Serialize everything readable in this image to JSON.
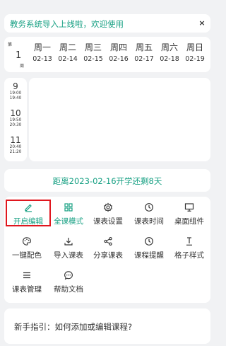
{
  "notice": {
    "text": "教务系统导入上线啦，欢迎使用",
    "close_glyph": "×"
  },
  "week": {
    "prefix": "第",
    "number": "1",
    "suffix": "周",
    "days": [
      {
        "name": "周一",
        "date": "02-13"
      },
      {
        "name": "周二",
        "date": "02-14"
      },
      {
        "name": "周三",
        "date": "02-15"
      },
      {
        "name": "周四",
        "date": "02-16"
      },
      {
        "name": "周五",
        "date": "02-17"
      },
      {
        "name": "周六",
        "date": "02-18"
      },
      {
        "name": "周日",
        "date": "02-19"
      }
    ]
  },
  "periods": [
    {
      "num": "9",
      "start": "19:00",
      "end": "19:40"
    },
    {
      "num": "10",
      "start": "19:50",
      "end": "20:30"
    },
    {
      "num": "11",
      "start": "20:40",
      "end": "21:20"
    }
  ],
  "countdown": {
    "text": "距离2023-02-16开学还剩8天"
  },
  "toolbar": {
    "accent": "#17a083",
    "highlight_color": "#e0161e",
    "items": [
      {
        "label": "开启编辑",
        "icon": "pencil-icon"
      },
      {
        "label": "全课模式",
        "icon": "grid-icon"
      },
      {
        "label": "课表设置",
        "icon": "gear-icon"
      },
      {
        "label": "课表时间",
        "icon": "clock-icon"
      },
      {
        "label": "桌面组件",
        "icon": "monitor-icon"
      },
      {
        "label": "一键配色",
        "icon": "palette-icon"
      },
      {
        "label": "导入课表",
        "icon": "download-icon"
      },
      {
        "label": "分享课表",
        "icon": "share-icon"
      },
      {
        "label": "课程提醒",
        "icon": "alarm-icon"
      },
      {
        "label": "格子样式",
        "icon": "text-cursor-icon"
      },
      {
        "label": "课表管理",
        "icon": "menu-icon"
      },
      {
        "label": "帮助文档",
        "icon": "chat-icon"
      }
    ]
  },
  "guide": {
    "text": "新手指引：如何添加或编辑课程?"
  }
}
